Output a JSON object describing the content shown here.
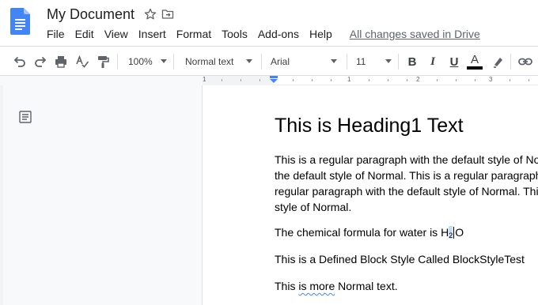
{
  "header": {
    "title": "My Document",
    "menu": [
      "File",
      "Edit",
      "View",
      "Insert",
      "Format",
      "Tools",
      "Add-ons",
      "Help"
    ],
    "save_status": "All changes saved in Drive"
  },
  "toolbar": {
    "zoom": "100%",
    "style": "Normal text",
    "font": "Arial",
    "font_size": "11",
    "bold_label": "B",
    "italic_label": "I",
    "underline_label": "U",
    "text_color_label": "A",
    "text_color": "#000000"
  },
  "ruler": {
    "numbers": [
      "1",
      "1",
      "2",
      "3"
    ]
  },
  "document": {
    "heading": "This is Heading1 Text",
    "paragraph_lines": [
      "This is a regular paragraph with the default style of Normal. This is a regular paragraph with",
      "the default style of Normal. This is a regular paragraph with the default style of Normal. This is a",
      "regular paragraph with the default style of Normal. This is a regular paragraph with the default",
      "style of Normal."
    ],
    "formula_prefix": "The chemical formula for water is H",
    "formula_sub": "2",
    "formula_suffix": "O",
    "block_style": "This is a Defined Block Style Called BlockStyleTest",
    "normal_more_prefix": "This ",
    "normal_more_misspelled": "is more",
    "normal_more_suffix": " Normal text."
  },
  "colors": {
    "docs_blue": "#4285f4",
    "icon_gray": "#5f6368",
    "ruler_marker": "#4285f4"
  },
  "icons": [
    "docs-logo-icon",
    "star-icon",
    "move-to-folder-icon",
    "undo-icon",
    "redo-icon",
    "print-icon",
    "spellcheck-icon",
    "paint-format-icon",
    "highlight-icon",
    "link-icon",
    "document-outline-icon"
  ]
}
